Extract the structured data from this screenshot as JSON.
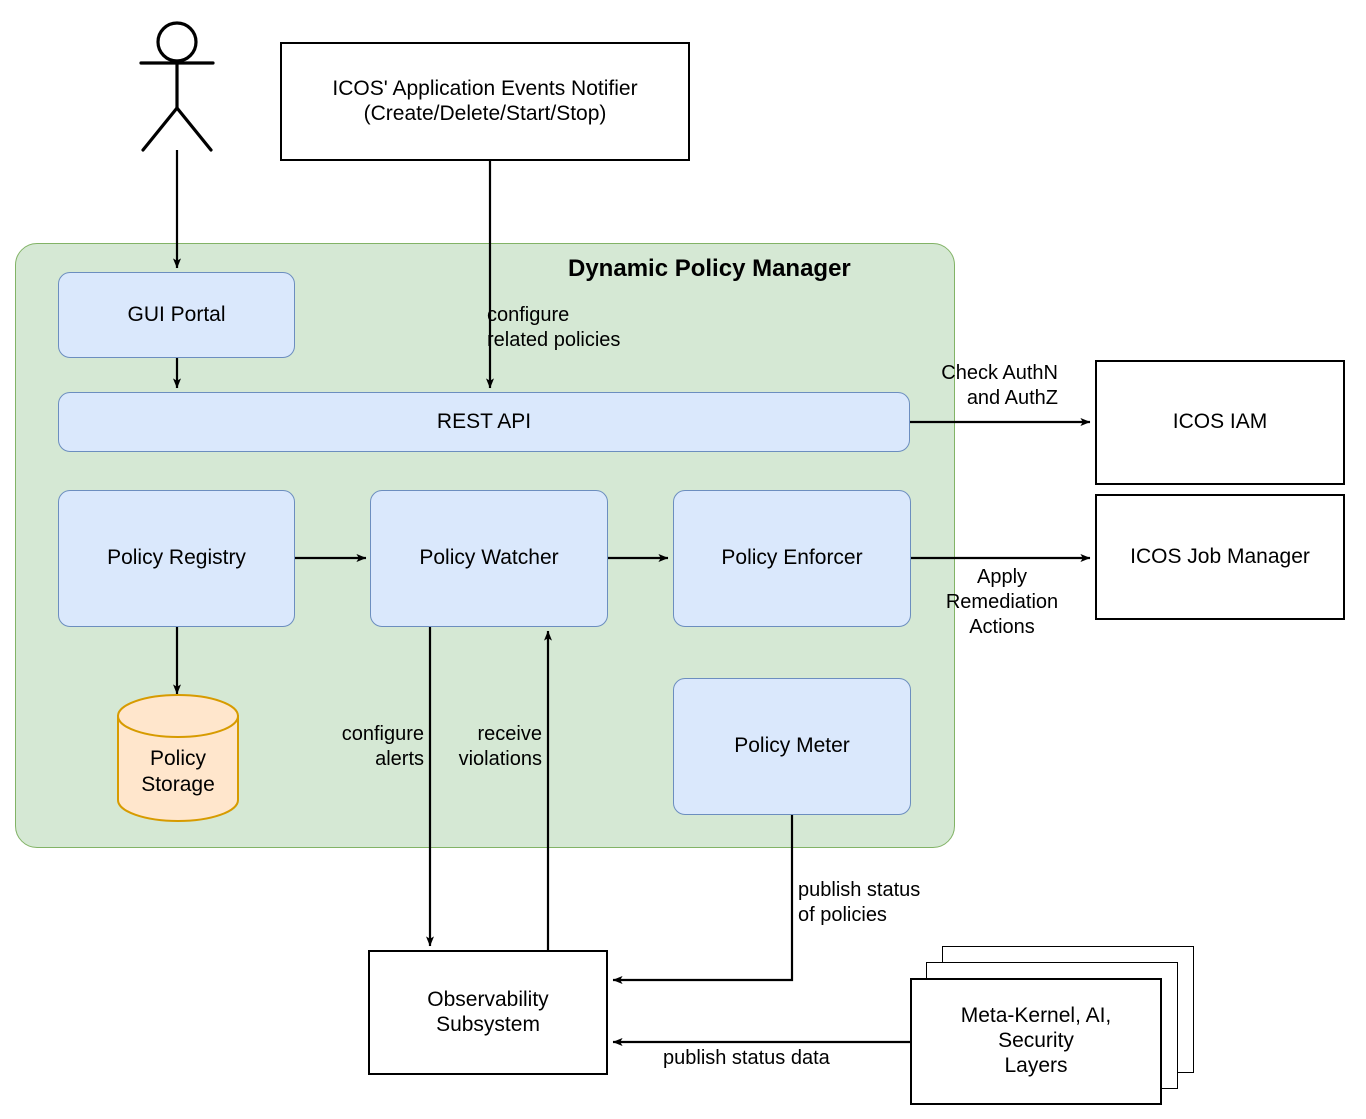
{
  "diagram": {
    "title": "Dynamic Policy Manager",
    "actor": {
      "name": "user-actor"
    }
  },
  "external_nodes": {
    "notifier": {
      "line1": "ICOS' Application Events Notifier",
      "line2": "(Create/Delete/Start/Stop)"
    },
    "icos_iam": "ICOS IAM",
    "icos_job_manager": "ICOS Job Manager",
    "observability": {
      "line1": "Observability",
      "line2": "Subsystem"
    },
    "layers": {
      "line1": "Meta-Kernel, AI,",
      "line2": "Security",
      "line3": "Layers"
    }
  },
  "group_nodes": {
    "gui_portal": "GUI Portal",
    "rest_api": "REST API",
    "policy_registry": "Policy Registry",
    "policy_watcher": "Policy Watcher",
    "policy_enforcer": "Policy Enforcer",
    "policy_meter": "Policy Meter",
    "policy_storage": {
      "line1": "Policy",
      "line2": "Storage"
    }
  },
  "edge_labels": {
    "configure_related_policies": "configure\nrelated policies",
    "check_authn_authz": "Check AuthN\nand AuthZ",
    "apply_remediation_actions": "Apply\nRemediation\nActions",
    "configure_alerts": "configure\nalerts",
    "receive_violations": "receive\nviolations",
    "publish_status_of_policies": "publish status\nof policies",
    "publish_status_data": "publish status data"
  },
  "colors": {
    "group_fill": "#d5e8d4",
    "group_stroke": "#82b366",
    "box_fill": "#dae8fc",
    "box_stroke": "#6c8ebf",
    "cylinder_fill": "#ffe6cc",
    "cylinder_stroke": "#d79b00",
    "line": "#000000",
    "background": "#ffffff"
  }
}
